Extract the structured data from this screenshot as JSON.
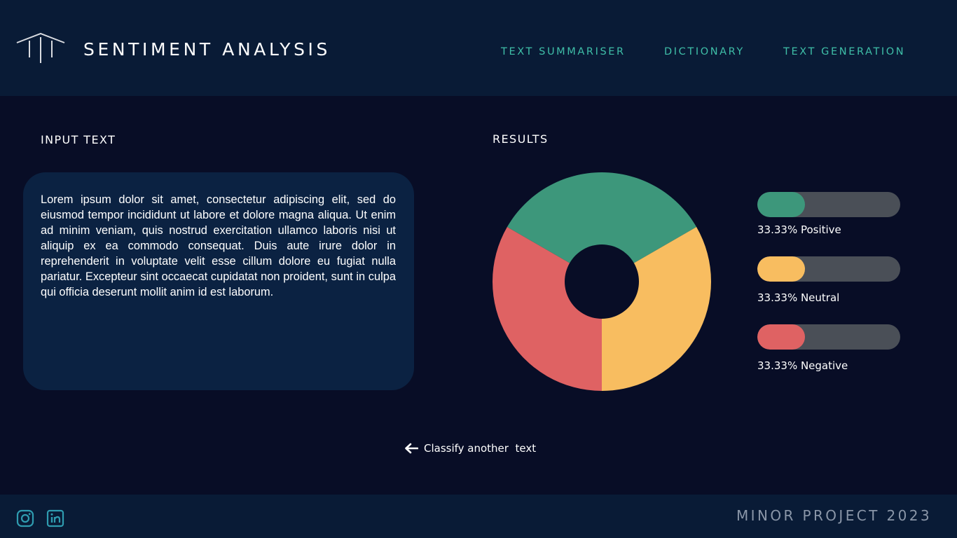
{
  "header": {
    "logo_icon": "pillars-logo-icon",
    "title": "SENTIMENT ANALYSIS",
    "nav": [
      {
        "label": "TEXT SUMMARISER"
      },
      {
        "label": "DICTIONARY"
      },
      {
        "label": "TEXT GENERATION"
      }
    ]
  },
  "input": {
    "label": "INPUT TEXT",
    "text": "Lorem ipsum dolor sit amet, consectetur adipiscing elit, sed do eiusmod tempor incididunt ut labore et dolore magna aliqua. Ut enim ad minim veniam, quis nostrud exercitation ullamco laboris nisi ut aliquip ex ea commodo consequat. Duis aute irure dolor in reprehenderit in voluptate velit esse cillum dolore eu fugiat nulla pariatur. Excepteur sint occaecat cupidatat non proident, sunt in culpa qui officia deserunt mollit anim id est laborum."
  },
  "results": {
    "label": "RESULTS",
    "items": [
      {
        "label": "33.33% Positive",
        "fraction": 0.3333,
        "color": "#3d977b"
      },
      {
        "label": "33.33% Neutral",
        "fraction": 0.3333,
        "color": "#f8bd60"
      },
      {
        "label": "33.33% Negative",
        "fraction": 0.3333,
        "color": "#df6263"
      }
    ]
  },
  "chart_data": {
    "type": "pie",
    "donut": true,
    "categories": [
      "Positive",
      "Neutral",
      "Negative"
    ],
    "values": [
      33.33,
      33.33,
      33.33
    ],
    "colors": [
      "#3d977b",
      "#f8bd60",
      "#df6263"
    ],
    "title": ""
  },
  "actions": {
    "back_icon": "arrow-left-icon",
    "back_label": "Classify another  text"
  },
  "footer": {
    "social": [
      "instagram-icon",
      "linkedin-icon"
    ],
    "text": "MINOR PROJECT 2023"
  },
  "colors": {
    "background": "#080d26",
    "header": "#091b36",
    "accent": "#3fbfa8",
    "panel": "#0b2242",
    "track": "#4a4f57"
  }
}
